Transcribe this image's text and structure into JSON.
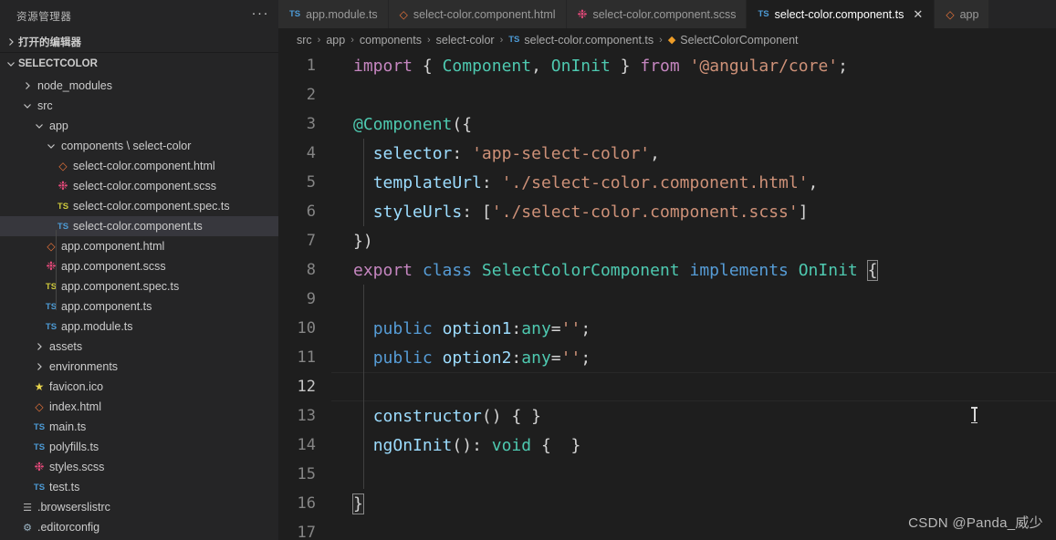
{
  "sidebar": {
    "title": "资源管理器",
    "more_label": "···",
    "open_editors_label": "打开的编辑器",
    "project_label": "SELECTCOLOR",
    "tree": [
      {
        "label": "node_modules",
        "depth": 1,
        "kind": "folder",
        "state": "collapsed",
        "icon": "chevron-right-icon"
      },
      {
        "label": "src",
        "depth": 1,
        "kind": "folder",
        "state": "expanded",
        "icon": "chevron-down-icon"
      },
      {
        "label": "app",
        "depth": 2,
        "kind": "folder",
        "state": "expanded",
        "icon": "chevron-down-icon"
      },
      {
        "label": "components \\ select-color",
        "depth": 3,
        "kind": "folder",
        "state": "expanded",
        "icon": "chevron-down-icon"
      },
      {
        "label": "select-color.component.html",
        "depth": 4,
        "kind": "file",
        "icon": "html-file-icon"
      },
      {
        "label": "select-color.component.scss",
        "depth": 4,
        "kind": "file",
        "icon": "scss-file-icon"
      },
      {
        "label": "select-color.component.spec.ts",
        "depth": 4,
        "kind": "file",
        "icon": "spec-file-icon"
      },
      {
        "label": "select-color.component.ts",
        "depth": 4,
        "kind": "file",
        "icon": "ts-file-icon",
        "selected": true
      },
      {
        "label": "app.component.html",
        "depth": 3,
        "kind": "file",
        "icon": "html-file-icon"
      },
      {
        "label": "app.component.scss",
        "depth": 3,
        "kind": "file",
        "icon": "scss-file-icon"
      },
      {
        "label": "app.component.spec.ts",
        "depth": 3,
        "kind": "file",
        "icon": "spec-file-icon"
      },
      {
        "label": "app.component.ts",
        "depth": 3,
        "kind": "file",
        "icon": "ts-file-icon"
      },
      {
        "label": "app.module.ts",
        "depth": 3,
        "kind": "file",
        "icon": "ts-file-icon"
      },
      {
        "label": "assets",
        "depth": 2,
        "kind": "folder",
        "state": "collapsed",
        "icon": "chevron-right-icon"
      },
      {
        "label": "environments",
        "depth": 2,
        "kind": "folder",
        "state": "collapsed",
        "icon": "chevron-right-icon"
      },
      {
        "label": "favicon.ico",
        "depth": 2,
        "kind": "file",
        "icon": "star-file-icon"
      },
      {
        "label": "index.html",
        "depth": 2,
        "kind": "file",
        "icon": "html-file-icon"
      },
      {
        "label": "main.ts",
        "depth": 2,
        "kind": "file",
        "icon": "ts-file-icon"
      },
      {
        "label": "polyfills.ts",
        "depth": 2,
        "kind": "file",
        "icon": "ts-file-icon"
      },
      {
        "label": "styles.scss",
        "depth": 2,
        "kind": "file",
        "icon": "scss-file-icon"
      },
      {
        "label": "test.ts",
        "depth": 2,
        "kind": "file",
        "icon": "ts-file-icon"
      },
      {
        "label": ".browserslistrc",
        "depth": 1,
        "kind": "file",
        "icon": "list-file-icon"
      },
      {
        "label": ".editorconfig",
        "depth": 1,
        "kind": "file",
        "icon": "gear-file-icon"
      }
    ]
  },
  "tabs": [
    {
      "label": "app.module.ts",
      "icon": "ts-file-icon",
      "active": false,
      "close_label": ""
    },
    {
      "label": "select-color.component.html",
      "icon": "html-file-icon",
      "active": false,
      "close_label": ""
    },
    {
      "label": "select-color.component.scss",
      "icon": "scss-file-icon",
      "active": false,
      "close_label": ""
    },
    {
      "label": "select-color.component.ts",
      "icon": "ts-file-icon",
      "active": true,
      "close_label": "✕"
    },
    {
      "label": "app",
      "icon": "html-file-icon",
      "active": false,
      "close_label": ""
    }
  ],
  "breadcrumb": [
    {
      "label": "src",
      "icon": ""
    },
    {
      "label": "app",
      "icon": ""
    },
    {
      "label": "components",
      "icon": ""
    },
    {
      "label": "select-color",
      "icon": ""
    },
    {
      "label": "select-color.component.ts",
      "icon": "ts-file-icon"
    },
    {
      "label": "SelectColorComponent",
      "icon": "class-symbol-icon"
    }
  ],
  "breadcrumb_separator": "›",
  "code": {
    "lines": [
      {
        "n": "1",
        "current": false
      },
      {
        "n": "2",
        "current": false
      },
      {
        "n": "3",
        "current": false
      },
      {
        "n": "4",
        "current": false
      },
      {
        "n": "5",
        "current": false
      },
      {
        "n": "6",
        "current": false
      },
      {
        "n": "7",
        "current": false
      },
      {
        "n": "8",
        "current": false
      },
      {
        "n": "9",
        "current": false
      },
      {
        "n": "10",
        "current": false
      },
      {
        "n": "11",
        "current": false
      },
      {
        "n": "12",
        "current": true
      },
      {
        "n": "13",
        "current": false
      },
      {
        "n": "14",
        "current": false
      },
      {
        "n": "15",
        "current": false
      },
      {
        "n": "16",
        "current": false
      },
      {
        "n": "17",
        "current": false
      }
    ],
    "text": [
      "import { Component, OnInit } from '@angular/core';",
      "",
      "@Component({",
      "  selector: 'app-select-color',",
      "  templateUrl: './select-color.component.html',",
      "  styleUrls: ['./select-color.component.scss']",
      "})",
      "export class SelectColorComponent implements OnInit {",
      "",
      "  public option1:any='';",
      "  public option2:any='';",
      "",
      "  constructor() { }",
      "  ngOnInit(): void {  }",
      "",
      "}",
      ""
    ]
  },
  "watermark": "CSDN @Panda_威少",
  "colors": {
    "editor_bg": "#1e1e1e",
    "sidebar_bg": "#252526",
    "tab_inactive_bg": "#2d2d2d",
    "selection_bg": "#37373d",
    "keyword": "#c586c0",
    "keyword_blue": "#569cd6",
    "type_green": "#4ec9b0",
    "identifier": "#9cdcfe",
    "string": "#ce9178",
    "line_number": "#858585"
  }
}
